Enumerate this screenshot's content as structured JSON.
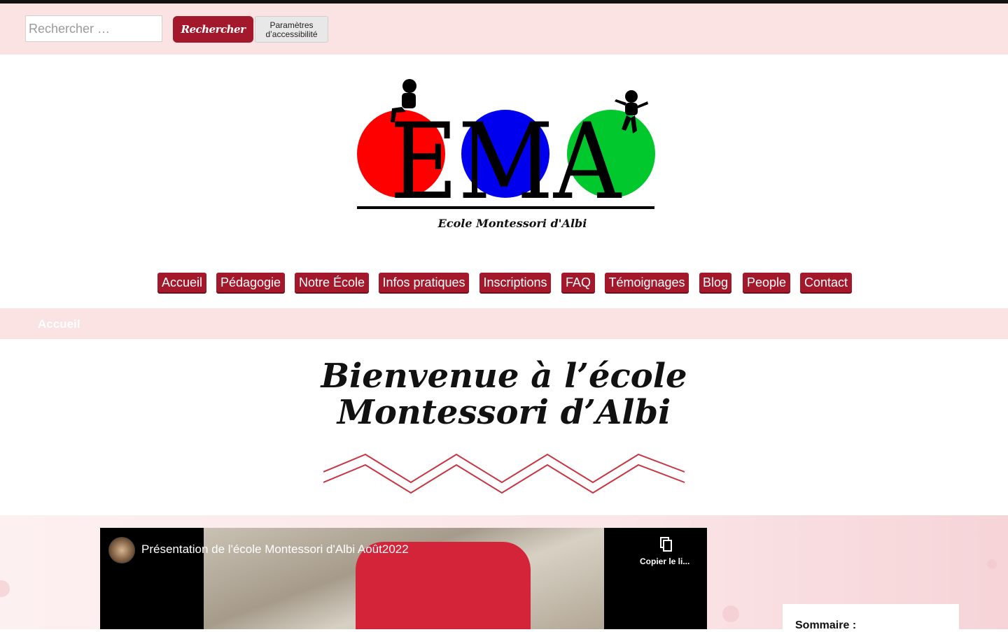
{
  "search": {
    "placeholder": "Rechercher …",
    "button": "Rechercher",
    "accessibility": "Paramètres d’accessibilité"
  },
  "logo": {
    "text": "EMA",
    "subtitle": "Ecole Montessori d'Albi",
    "circle_colors": [
      "#ff0000",
      "#0000ee",
      "#00c82d"
    ]
  },
  "nav": {
    "items": [
      "Accueil",
      "Pédagogie",
      "Notre École",
      "Infos pratiques",
      "Inscriptions",
      "FAQ",
      "Témoignages",
      "Blog",
      "People",
      "Contact"
    ]
  },
  "breadcrumb": {
    "current": "Accueil"
  },
  "hero": {
    "title": "Bienvenue à l’école Montessori d’Albi"
  },
  "video": {
    "title": "Présentation de l'école Montessori d'Albi Août2022",
    "copy_label": "Copier le li..."
  },
  "sidebar": {
    "summary_title": "Sommaire :"
  },
  "colors": {
    "accent": "#a3182b",
    "pink_band": "#fbe3e4",
    "zigzag": "#c8343f"
  }
}
